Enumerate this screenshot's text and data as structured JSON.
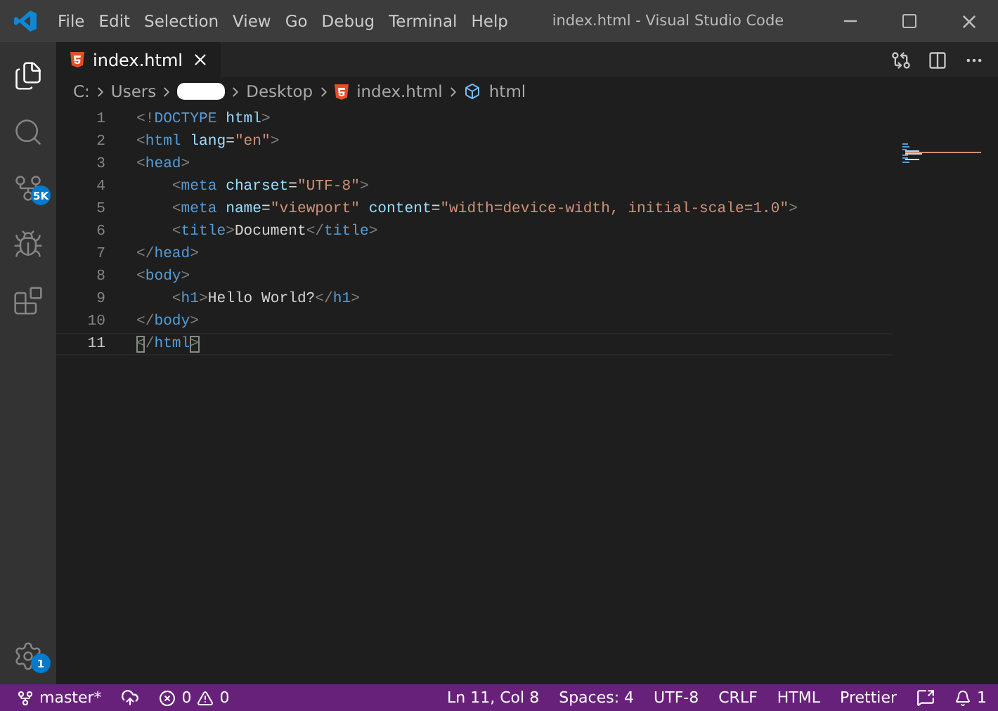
{
  "window": {
    "title": "index.html - Visual Studio Code"
  },
  "menu": [
    "File",
    "Edit",
    "Selection",
    "View",
    "Go",
    "Debug",
    "Terminal",
    "Help"
  ],
  "activity_bar": [
    {
      "kind": "files",
      "selected": true
    },
    {
      "kind": "search",
      "selected": false
    },
    {
      "kind": "source-control",
      "selected": false,
      "badge": "5K"
    },
    {
      "kind": "debug",
      "selected": false
    },
    {
      "kind": "extensions",
      "selected": false
    }
  ],
  "settings_badge": "1",
  "tabs": [
    {
      "label": "index.html",
      "selected": true
    }
  ],
  "breadcrumb": [
    {
      "kind": "text",
      "label": "C:"
    },
    {
      "kind": "text",
      "label": "Users"
    },
    {
      "kind": "redacted"
    },
    {
      "kind": "text",
      "label": "Desktop"
    },
    {
      "kind": "file",
      "label": "index.html"
    },
    {
      "kind": "element",
      "label": "html"
    }
  ],
  "code_lines": [
    {
      "number": "1",
      "current": false,
      "tokens": [
        {
          "kind": "punct",
          "text": "<!"
        },
        {
          "kind": "tag",
          "text": "DOCTYPE"
        },
        {
          "kind": "attr",
          "text": " html"
        },
        {
          "kind": "punct",
          "text": ">"
        }
      ]
    },
    {
      "number": "2",
      "current": false,
      "tokens": [
        {
          "kind": "punct",
          "text": "<"
        },
        {
          "kind": "tag",
          "text": "html"
        },
        {
          "kind": "attr",
          "text": " lang"
        },
        {
          "kind": "text",
          "text": "="
        },
        {
          "kind": "string",
          "text": "\"en\""
        },
        {
          "kind": "punct",
          "text": ">"
        }
      ]
    },
    {
      "number": "3",
      "current": false,
      "tokens": [
        {
          "kind": "punct",
          "text": "<"
        },
        {
          "kind": "tag",
          "text": "head"
        },
        {
          "kind": "punct",
          "text": ">"
        }
      ]
    },
    {
      "number": "4",
      "current": false,
      "tokens": [
        {
          "kind": "punct",
          "text": "    <"
        },
        {
          "kind": "tag",
          "text": "meta"
        },
        {
          "kind": "attr",
          "text": " charset"
        },
        {
          "kind": "text",
          "text": "="
        },
        {
          "kind": "string",
          "text": "\"UTF-8\""
        },
        {
          "kind": "punct",
          "text": ">"
        }
      ]
    },
    {
      "number": "5",
      "current": false,
      "tokens": [
        {
          "kind": "punct",
          "text": "    <"
        },
        {
          "kind": "tag",
          "text": "meta"
        },
        {
          "kind": "attr",
          "text": " name"
        },
        {
          "kind": "text",
          "text": "="
        },
        {
          "kind": "string",
          "text": "\"viewport\""
        },
        {
          "kind": "attr",
          "text": " content"
        },
        {
          "kind": "text",
          "text": "="
        },
        {
          "kind": "string",
          "text": "\"width=device-width, initial-scale=1.0\""
        },
        {
          "kind": "punct",
          "text": ">"
        }
      ]
    },
    {
      "number": "6",
      "current": false,
      "tokens": [
        {
          "kind": "punct",
          "text": "    <"
        },
        {
          "kind": "tag",
          "text": "title"
        },
        {
          "kind": "punct",
          "text": ">"
        },
        {
          "kind": "text",
          "text": "Document"
        },
        {
          "kind": "punct",
          "text": "</"
        },
        {
          "kind": "tag",
          "text": "title"
        },
        {
          "kind": "punct",
          "text": ">"
        }
      ]
    },
    {
      "number": "7",
      "current": false,
      "tokens": [
        {
          "kind": "punct",
          "text": "</"
        },
        {
          "kind": "tag",
          "text": "head"
        },
        {
          "kind": "punct",
          "text": ">"
        }
      ]
    },
    {
      "number": "8",
      "current": false,
      "tokens": [
        {
          "kind": "punct",
          "text": "<"
        },
        {
          "kind": "tag",
          "text": "body"
        },
        {
          "kind": "punct",
          "text": ">"
        }
      ]
    },
    {
      "number": "9",
      "current": false,
      "tokens": [
        {
          "kind": "punct",
          "text": "    <"
        },
        {
          "kind": "tag",
          "text": "h1"
        },
        {
          "kind": "punct",
          "text": ">"
        },
        {
          "kind": "text",
          "text": "Hello World?"
        },
        {
          "kind": "punct",
          "text": "</"
        },
        {
          "kind": "tag",
          "text": "h1"
        },
        {
          "kind": "punct",
          "text": ">"
        }
      ]
    },
    {
      "number": "10",
      "current": false,
      "tokens": [
        {
          "kind": "punct",
          "text": "</"
        },
        {
          "kind": "tag",
          "text": "body"
        },
        {
          "kind": "punct",
          "text": ">"
        }
      ]
    },
    {
      "number": "11",
      "current": true,
      "tokens": [
        {
          "kind": "match",
          "text": "<"
        },
        {
          "kind": "punct",
          "text": "/"
        },
        {
          "kind": "tag",
          "text": "html"
        },
        {
          "kind": "match",
          "text": ">"
        }
      ]
    }
  ],
  "status_bar": {
    "branch": "master*",
    "errors": "0",
    "warnings": "0",
    "right": [
      "Ln 11, Col 8",
      "Spaces: 4",
      "UTF-8",
      "CRLF",
      "HTML",
      "Prettier"
    ],
    "notifications": "1"
  }
}
